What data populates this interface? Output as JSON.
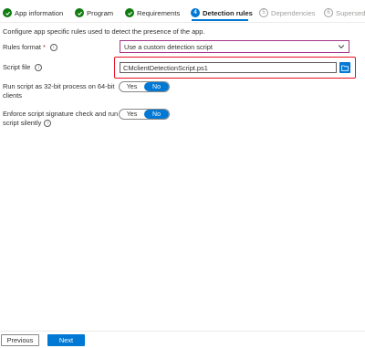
{
  "steps": [
    {
      "label": "App information",
      "status": "done"
    },
    {
      "label": "Program",
      "status": "done"
    },
    {
      "label": "Requirements",
      "status": "done"
    },
    {
      "number": "4",
      "label": "Detection rules",
      "status": "active"
    },
    {
      "number": "5",
      "label": "Dependencies",
      "status": "pending"
    },
    {
      "number": "6",
      "label": "Supersede",
      "status": "pending"
    }
  ],
  "description": "Configure app specific rules used to detect the presence of the app.",
  "rules_format": {
    "label": "Rules format",
    "required_mark": "*",
    "value": "Use a custom detection script"
  },
  "script_file": {
    "label": "Script file",
    "value": "CMclientDetectionScript.ps1"
  },
  "run_32bit": {
    "label_line1": "Run script as 32-bit process on 64-bit",
    "label_line2": "clients",
    "yes": "Yes",
    "no": "No",
    "selected": "No"
  },
  "enforce_signature": {
    "label_line1": "Enforce script signature check and run",
    "label_line2": "script silently",
    "yes": "Yes",
    "no": "No",
    "selected": "No"
  },
  "footer": {
    "previous": "Previous",
    "next": "Next"
  },
  "colors": {
    "accent": "#0078d4",
    "done": "#107c10",
    "highlight": "#e81123",
    "dropdown_border": "#a4378a"
  }
}
